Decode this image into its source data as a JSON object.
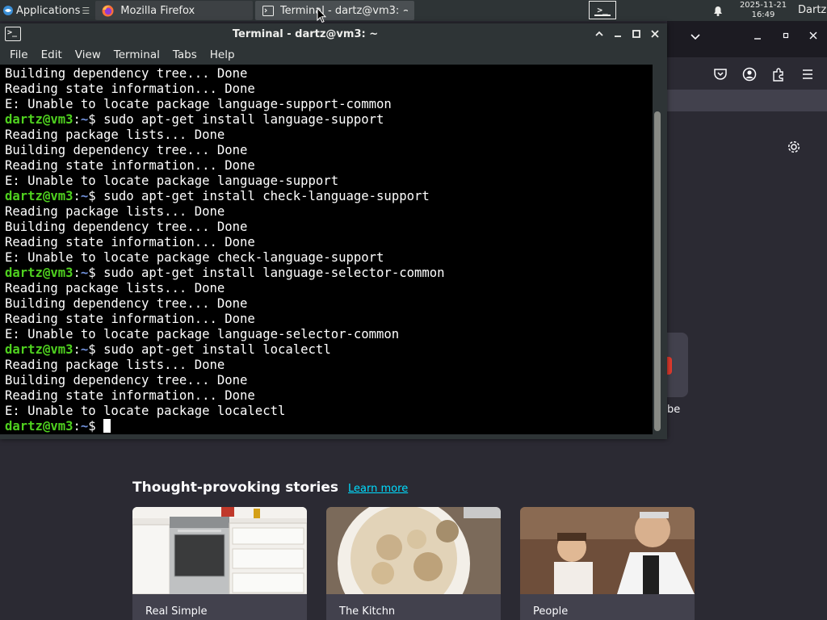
{
  "panel": {
    "applications_label": "Applications",
    "applications_sep": "☰",
    "tasks": [
      {
        "label": "Mozilla Firefox"
      },
      {
        "label": "Terminal - dartz@vm3: ~"
      }
    ],
    "clock_date": "2025-11-21",
    "clock_time": "16:49",
    "user": "Dartz"
  },
  "terminal": {
    "title": "Terminal - dartz@vm3: ~",
    "menu": [
      "File",
      "Edit",
      "View",
      "Terminal",
      "Tabs",
      "Help"
    ],
    "prompt": {
      "user": "dartz@vm3",
      "sep": ":",
      "path": "~",
      "symbol": "$ "
    },
    "lines": [
      {
        "type": "out",
        "text": "Building dependency tree... Done"
      },
      {
        "type": "out",
        "text": "Reading state information... Done"
      },
      {
        "type": "out",
        "text": "E: Unable to locate package language-support-common"
      },
      {
        "type": "cmd",
        "text": "sudo apt-get install language-support"
      },
      {
        "type": "out",
        "text": "Reading package lists... Done"
      },
      {
        "type": "out",
        "text": "Building dependency tree... Done"
      },
      {
        "type": "out",
        "text": "Reading state information... Done"
      },
      {
        "type": "out",
        "text": "E: Unable to locate package language-support"
      },
      {
        "type": "cmd",
        "text": "sudo apt-get install check-language-support"
      },
      {
        "type": "out",
        "text": "Reading package lists... Done"
      },
      {
        "type": "out",
        "text": "Building dependency tree... Done"
      },
      {
        "type": "out",
        "text": "Reading state information... Done"
      },
      {
        "type": "out",
        "text": "E: Unable to locate package check-language-support"
      },
      {
        "type": "cmd",
        "text": "sudo apt-get install language-selector-common"
      },
      {
        "type": "out",
        "text": "Reading package lists... Done"
      },
      {
        "type": "out",
        "text": "Building dependency tree... Done"
      },
      {
        "type": "out",
        "text": "Reading state information... Done"
      },
      {
        "type": "out",
        "text": "E: Unable to locate package language-selector-common"
      },
      {
        "type": "cmd",
        "text": "sudo apt-get install localectl"
      },
      {
        "type": "out",
        "text": "Reading package lists... Done"
      },
      {
        "type": "out",
        "text": "Building dependency tree... Done"
      },
      {
        "type": "out",
        "text": "Reading state information... Done"
      },
      {
        "type": "out",
        "text": "E: Unable to locate package localectl"
      },
      {
        "type": "cmd",
        "text": ""
      }
    ]
  },
  "firefox": {
    "shortcut_label_fragment": "be",
    "stories": {
      "title": "Thought-provoking stories",
      "learn_more": "Learn more",
      "cards": [
        {
          "source": "Real Simple"
        },
        {
          "source": "The Kitchn"
        },
        {
          "source": "People"
        }
      ]
    }
  },
  "colors": {
    "prompt_user": "#4fd11f",
    "prompt_path": "#6f8fd8",
    "link": "#00ddff",
    "panel_bg": "#2e3436"
  }
}
